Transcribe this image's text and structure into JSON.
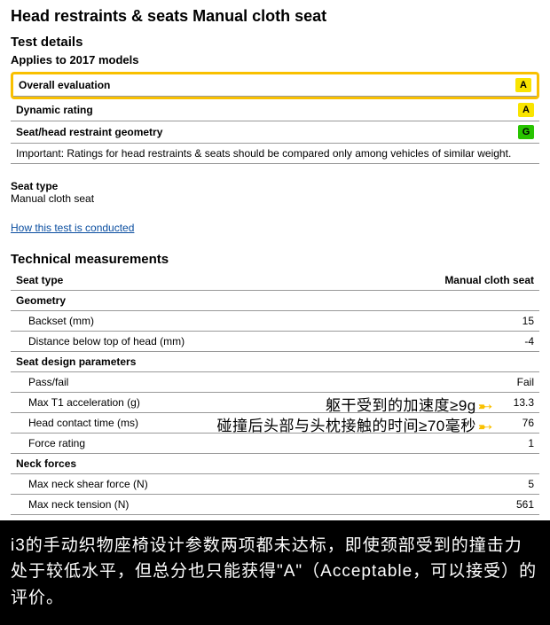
{
  "header": {
    "title": "Head restraints & seats Manual cloth seat",
    "section": "Test details",
    "applies": "Applies to 2017 models"
  },
  "evaluation": {
    "overall_label": "Overall evaluation",
    "overall_badge": "A",
    "dynamic_label": "Dynamic rating",
    "dynamic_badge": "A",
    "geometry_label": "Seat/head restraint geometry",
    "geometry_badge": "G",
    "important": "Important: Ratings for head restraints & seats should be compared only among vehicles of similar weight."
  },
  "seat": {
    "label": "Seat type",
    "value": "Manual cloth seat"
  },
  "link": {
    "text": "How this test is conducted"
  },
  "tech": {
    "title": "Technical measurements",
    "col1": "Seat type",
    "col2": "Manual cloth seat",
    "geometry_header": "Geometry",
    "backset_label": "Backset (mm)",
    "backset_value": "15",
    "distance_label": "Distance below top of head (mm)",
    "distance_value": "-4",
    "design_header": "Seat design parameters",
    "pass_label": "Pass/fail",
    "pass_value": "Fail",
    "maxt1_label": "Max T1 acceleration (g)",
    "maxt1_value": "13.3",
    "contact_label": "Head contact time (ms)",
    "contact_value": "76",
    "force_label": "Force rating",
    "force_value": "1",
    "neck_header": "Neck forces",
    "shear_label": "Max neck shear force (N)",
    "shear_value": "5",
    "tension_label": "Max neck tension (N)",
    "tension_value": "561"
  },
  "annotations": {
    "accel": "躯干受到的加速度≥9g",
    "contact": "碰撞后头部与头枕接触的时间≥70毫秒"
  },
  "footer": {
    "text": "i3的手动织物座椅设计参数两项都未达标，即使颈部受到的撞击力处于较低水平，但总分也只能获得\"A\"（Acceptable，可以接受）的评价。"
  },
  "chart_data": {
    "type": "table",
    "title": "Technical measurements — Manual cloth seat",
    "rows": [
      {
        "group": "Geometry",
        "metric": "Backset (mm)",
        "value": 15
      },
      {
        "group": "Geometry",
        "metric": "Distance below top of head (mm)",
        "value": -4
      },
      {
        "group": "Seat design parameters",
        "metric": "Pass/fail",
        "value": "Fail"
      },
      {
        "group": "Seat design parameters",
        "metric": "Max T1 acceleration (g)",
        "value": 13.3
      },
      {
        "group": "Seat design parameters",
        "metric": "Head contact time (ms)",
        "value": 76
      },
      {
        "group": "Seat design parameters",
        "metric": "Force rating",
        "value": 1
      },
      {
        "group": "Neck forces",
        "metric": "Max neck shear force (N)",
        "value": 5
      },
      {
        "group": "Neck forces",
        "metric": "Max neck tension (N)",
        "value": 561
      }
    ],
    "ratings": {
      "Overall evaluation": "A",
      "Dynamic rating": "A",
      "Seat/head restraint geometry": "G"
    }
  }
}
